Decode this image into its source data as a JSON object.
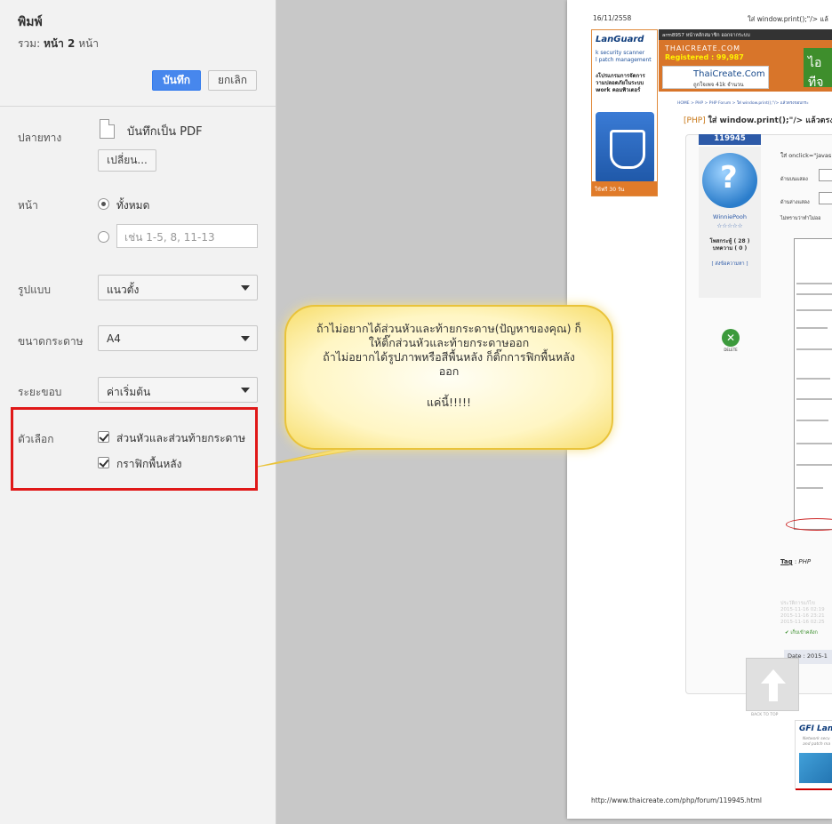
{
  "panel": {
    "title": "พิมพ์",
    "total_prefix": "รวม:",
    "total_bold": "หน้า 2",
    "total_suffix": "หน้า",
    "save_label": "บันทึก",
    "cancel_label": "ยกเลิก",
    "destination": {
      "label": "ปลายทาง",
      "value": "บันทึกเป็น PDF",
      "change_label": "เปลี่ยน..."
    },
    "pages": {
      "label": "หน้า",
      "all_label": "ทั้งหมด",
      "custom_placeholder": "เช่น 1-5, 8, 11-13"
    },
    "layout": {
      "label": "รูปแบบ",
      "value": "แนวตั้ง"
    },
    "paper": {
      "label": "ขนาดกระดาษ",
      "value": "A4"
    },
    "margins": {
      "label": "ระยะขอบ",
      "value": "ค่าเริ่มต้น"
    },
    "options": {
      "label": "ตัวเลือก",
      "headers_footers": "ส่วนหัวและส่วนท้ายกระดาษ",
      "background_graphics": "กราฟิกพื้นหลัง"
    }
  },
  "callout": {
    "line1": "ถ้าไม่อยากได้ส่วนหัวและท้ายกระดาษ(ปัญหาของคุณ) ก็",
    "line2": "ให้ติ๊กส่วนหัวและท้ายกระดาษออก",
    "line3": "ถ้าไม่อยากได้รูปภาพหรือสีพื้นหลัง ก็ติ๊กการฟิกพื้นหลัง",
    "line4": "ออก",
    "line5": "แค่นี้!!!!!"
  },
  "preview": {
    "date": "16/11/2558",
    "page_title": "ใส่ window.print();\"/> แล้",
    "footer_url": "http://www.thaicreate.com/php/forum/119945.html",
    "lanad_logo": "LanGuard",
    "lanad_text1": "k security scanner",
    "lanad_text2": "l patch management",
    "lanad_text3": "งโปรแกรมการจัดการ",
    "lanad_text4": "วามปลอดภัยในระบบ",
    "lanad_text5": "work คอมพิวเตอร์",
    "lanad_foot": "ใช้ฟรี 30 วัน",
    "topbar": "arm8957  หน้าหลักสมาชิก  ออกจากระบบ",
    "site_name": "THAICREATE.COM",
    "registered": "Registered : 99,987",
    "logo_name": "ThaiCreate.Com",
    "logo_fans": "ถูกใจเพจ  41k จำนวน",
    "ad_green": "ไอทีจ",
    "breadcrumb": "HOME > PHP > PHP Forum > ใส่ window.print();\"/> แล้วตรงขอบกระ",
    "post_prefix": "[PHP]",
    "post_title": "ใส่ window.print();\"/> แล้วตรงขอ",
    "post_id": "119945",
    "username": "WinniePooh",
    "user_stars": "☆☆☆☆☆",
    "user_posts": "โพสกระทู้ ( 28 )",
    "user_answers": "บทความ ( 0 )",
    "user_link": "[ ส่งข้อความหา ]",
    "delete_label": "DELETE",
    "code_line": "ใส่ onclick=\"javas",
    "row_header": "ด้านบนแสดง",
    "row_footer": "ด้านล่างแสดง",
    "row_question": "ไม่ทราบว่าทำไม่ออ",
    "tag_label": "Tag",
    "tag_value": "PHP",
    "faded1": "ประวัติการแก้ไข",
    "faded2": "2015-11-16 02:19",
    "faded3": "2015-11-16 23:21",
    "faded4": "2015-11-16 02:25",
    "fav_text": "เก็บเข้าคลังก",
    "date_bar": "Date : 2015-1",
    "back_to_top": "BACK TO TOP",
    "gfi_logo": "GFI Lan",
    "gfi_sub1": "Network secu",
    "gfi_sub2": "and patch ma"
  },
  "colors": {
    "save_button": "#4787ed",
    "highlight_red": "#e01818",
    "callout_fill": "#fff6c4",
    "callout_border": "#e9c33a"
  }
}
